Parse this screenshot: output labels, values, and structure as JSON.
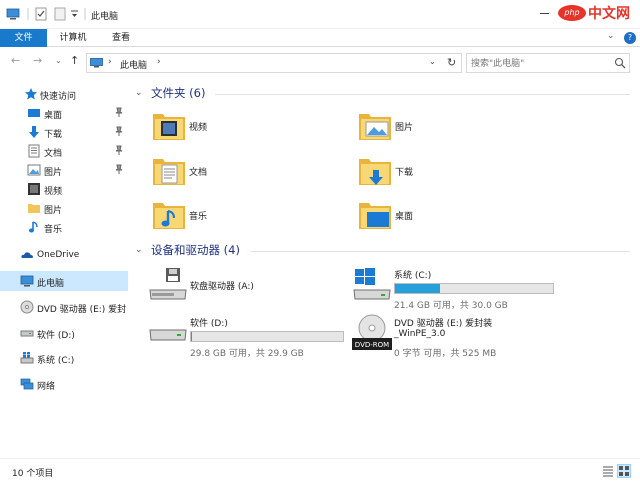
{
  "window": {
    "title": "此电脑"
  },
  "watermark": {
    "logo": "php",
    "text": "中文网"
  },
  "ribbon": {
    "tabs": [
      {
        "label": "文件",
        "active": true
      },
      {
        "label": "计算机",
        "active": false
      },
      {
        "label": "查看",
        "active": false
      }
    ],
    "help_glyph": "?",
    "expand_glyph": "⌄"
  },
  "address": {
    "breadcrumb": "此电脑",
    "separator": "›",
    "dropdown_glyph": "⌄",
    "refresh_glyph": "↻",
    "back_glyph": "←",
    "forward_glyph": "→",
    "history_glyph": "⌄",
    "up_glyph": "↑"
  },
  "search": {
    "placeholder": "搜索\"此电脑\""
  },
  "nav": {
    "items": [
      {
        "label": "快速访问",
        "icon": "star-icon"
      },
      {
        "label": "桌面",
        "icon": "desktop-icon",
        "pinned": true
      },
      {
        "label": "下载",
        "icon": "download-icon",
        "pinned": true
      },
      {
        "label": "文档",
        "icon": "document-icon",
        "pinned": true
      },
      {
        "label": "图片",
        "icon": "picture-icon",
        "pinned": true
      },
      {
        "label": "视频",
        "icon": "video-icon"
      },
      {
        "label": "图片",
        "icon": "folder-icon"
      },
      {
        "label": "音乐",
        "icon": "music-icon"
      },
      {
        "label": "OneDrive",
        "icon": "onedrive-icon"
      },
      {
        "label": "此电脑",
        "icon": "computer-icon",
        "selected": true
      },
      {
        "label": "DVD 驱动器 (E:) 爱封",
        "icon": "dvd-icon"
      },
      {
        "label": "软件 (D:)",
        "icon": "drive-icon"
      },
      {
        "label": "系统 (C:)",
        "icon": "system-drive-icon"
      },
      {
        "label": "网络",
        "icon": "network-icon"
      }
    ]
  },
  "folders_group": {
    "title": "文件夹 (6)",
    "chevron": "⌄",
    "items": [
      {
        "label": "视频",
        "icon": "video-folder-icon"
      },
      {
        "label": "图片",
        "icon": "pictures-folder-icon"
      },
      {
        "label": "文档",
        "icon": "documents-folder-icon"
      },
      {
        "label": "下载",
        "icon": "downloads-folder-icon"
      },
      {
        "label": "音乐",
        "icon": "music-folder-icon"
      },
      {
        "label": "桌面",
        "icon": "desktop-folder-icon"
      }
    ]
  },
  "drives_group": {
    "title": "设备和驱动器 (4)",
    "chevron": "⌄",
    "items": [
      {
        "name": "软盘驱动器 (A:)",
        "icon": "floppy-drive-icon"
      },
      {
        "name": "系统 (C:)",
        "icon": "windows-drive-icon",
        "info": "21.4 GB 可用，共 30.0 GB",
        "used_fraction": 0.287
      },
      {
        "name": "软件 (D:)",
        "icon": "hard-drive-icon",
        "info": "29.8 GB 可用，共 29.9 GB",
        "used_fraction": 0.003
      },
      {
        "name": "DVD 驱动器 (E:) 爱封装",
        "name2": "_WinPE_3.0",
        "icon": "dvd-rom-icon",
        "disc_label": "DVD-ROM",
        "info": "0 字节 可用，共 525 MB"
      }
    ]
  },
  "status": {
    "count": "10 个项目"
  },
  "colors": {
    "accent": "#1979ca",
    "selection": "#cce8ff",
    "bar_fill": "#26a0da",
    "group_title": "#1e3287"
  }
}
